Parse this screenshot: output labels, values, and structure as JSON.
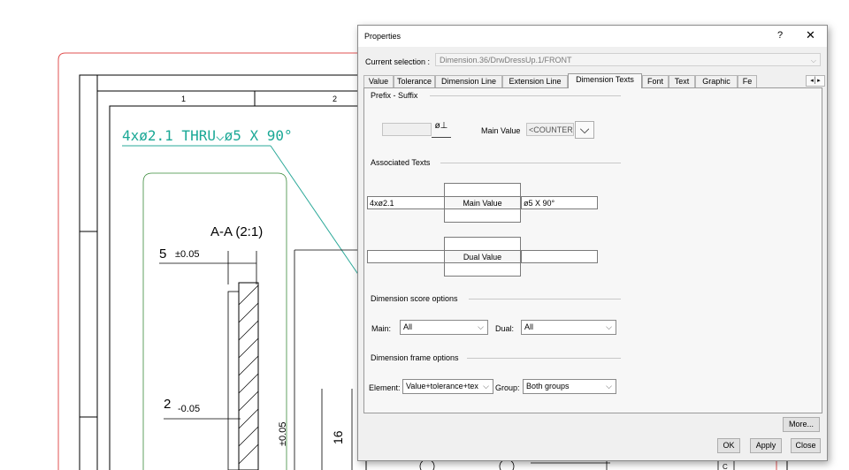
{
  "drawing": {
    "grid_labels": [
      "1",
      "2"
    ],
    "callout": "4xø2.1 THRU⌵ø5 X 90°",
    "section_title": "A-A (2:1)",
    "dim_top_value": "5",
    "dim_top_tol": "±0.05",
    "dim_mid_value": "2",
    "dim_mid_tol": "-0.05",
    "dim_vert_tol": "±0.05",
    "dim_vert_16": "16",
    "frame_letter": "C"
  },
  "dialog": {
    "title": "Properties",
    "help_label": "?",
    "close_label": "✕",
    "current_selection_label": "Current selection :",
    "current_selection_value": "Dimension.36/DrwDressUp.1/FRONT",
    "tabs": [
      "Value",
      "Tolerance",
      "Dimension Line",
      "Extension Line",
      "Dimension Texts",
      "Font",
      "Text",
      "Graphic",
      "Fe"
    ],
    "active_tab": "Dimension Texts",
    "tab_nav": "◂│▸",
    "prefix_suffix": {
      "group_label": "Prefix - Suffix",
      "symbol_glyph": "ø⊥",
      "main_value_label": "Main Value",
      "main_value_select": "<COUNTER:",
      "dropdown_glyph": "⌵"
    },
    "associated_texts": {
      "group_label": "Associated Texts",
      "main_left": "4xø2.1",
      "main_center": "Main Value",
      "main_right": "ø5 X 90°",
      "dual_center": "Dual Value"
    },
    "score_options": {
      "group_label": "Dimension score options",
      "main_label": "Main:",
      "main_value": "All",
      "dual_label": "Dual:",
      "dual_value": "All"
    },
    "frame_options": {
      "group_label": "Dimension frame options",
      "element_label": "Element:",
      "element_value": "Value+tolerance+tex",
      "group_label_field": "Group:",
      "group_value": "Both groups"
    },
    "buttons": {
      "more": "More...",
      "ok": "OK",
      "apply": "Apply",
      "close": "Close"
    }
  },
  "colors": {
    "callout": "#1aa896",
    "leader": "#2aa898",
    "frame_red": "#e05050",
    "view_frame": "#3a8a3a"
  }
}
